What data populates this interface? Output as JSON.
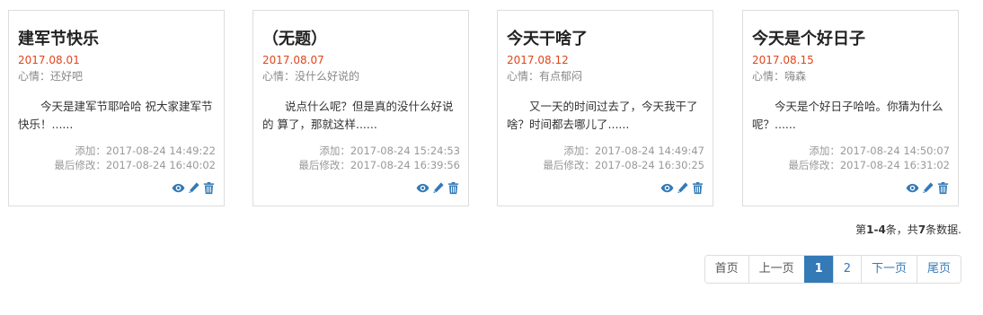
{
  "cards": [
    {
      "title": "建军节快乐",
      "date": "2017.08.01",
      "mood": "心情：还好吧",
      "content": "今天是建军节耶哈哈 祝大家建军节快乐！......",
      "added": "添加：2017-08-24 14:49:22",
      "modified": "最后修改：2017-08-24 16:40:02"
    },
    {
      "title": "（无题）",
      "date": "2017.08.07",
      "mood": "心情：没什么好说的",
      "content": "说点什么呢？但是真的没什么好说的 算了，那就这样......",
      "added": "添加：2017-08-24 15:24:53",
      "modified": "最后修改：2017-08-24 16:39:56"
    },
    {
      "title": "今天干啥了",
      "date": "2017.08.12",
      "mood": "心情：有点郁闷",
      "content": "又一天的时间过去了，今天我干了啥？时间都去哪儿了......",
      "added": "添加：2017-08-24 14:49:47",
      "modified": "最后修改：2017-08-24 16:30:25"
    },
    {
      "title": "今天是个好日子",
      "date": "2017.08.15",
      "mood": "心情：嗨森",
      "content": "今天是个好日子哈哈。你猜为什么呢？......",
      "added": "添加：2017-08-24 14:50:07",
      "modified": "最后修改：2017-08-24 16:31:02"
    }
  ],
  "icons": {
    "view": "eye-icon",
    "edit": "pencil-icon",
    "delete": "trash-icon"
  },
  "colors": {
    "accent": "#337ab7",
    "date": "#e0461a"
  },
  "summary": {
    "prefix": "第",
    "range": "1-4",
    "middle": "条，共",
    "total": "7",
    "suffix": "条数据."
  },
  "pagination": {
    "first": "首页",
    "prev": "上一页",
    "page1": "1",
    "page2": "2",
    "next": "下一页",
    "last": "尾页",
    "current": "1"
  }
}
